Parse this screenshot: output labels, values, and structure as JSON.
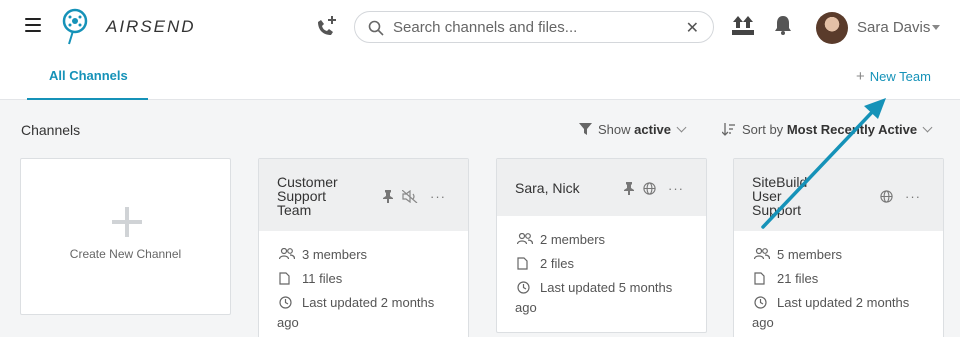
{
  "header": {
    "brand": "AIRSEND",
    "search": {
      "placeholder": "Search channels and files...",
      "value": ""
    },
    "user_name": "Sara Davis"
  },
  "tabs": {
    "all_channels": "All Channels",
    "new_team": "New Team"
  },
  "toolbar": {
    "title": "Channels",
    "filter_prefix": "Show",
    "filter_value": "active",
    "sort_prefix": "Sort by",
    "sort_value": "Most Recently Active"
  },
  "create_card": {
    "label": "Create New Channel"
  },
  "channels": [
    {
      "title_lines": [
        "Customer",
        "Support",
        "Team"
      ],
      "members": "3 members",
      "files": "11 files",
      "updated": "Last updated 2 months",
      "updated_tail": "ago",
      "pinned": true,
      "muted": true,
      "public": false
    },
    {
      "title_lines": [
        "Sara, Nick"
      ],
      "members": "2 members",
      "files": "2 files",
      "updated": "Last updated 5 months",
      "updated_tail": "ago",
      "pinned": true,
      "muted": false,
      "public": true
    },
    {
      "title_lines": [
        "SiteBuild",
        "User",
        "Support"
      ],
      "members": "5 members",
      "files": "21 files",
      "updated": "Last updated 2 months",
      "updated_tail": "ago",
      "pinned": false,
      "muted": false,
      "public": true
    }
  ],
  "colors": {
    "accent": "#1592b8",
    "card_header": "#eeeff0",
    "page_bg": "#f4f5f6"
  }
}
